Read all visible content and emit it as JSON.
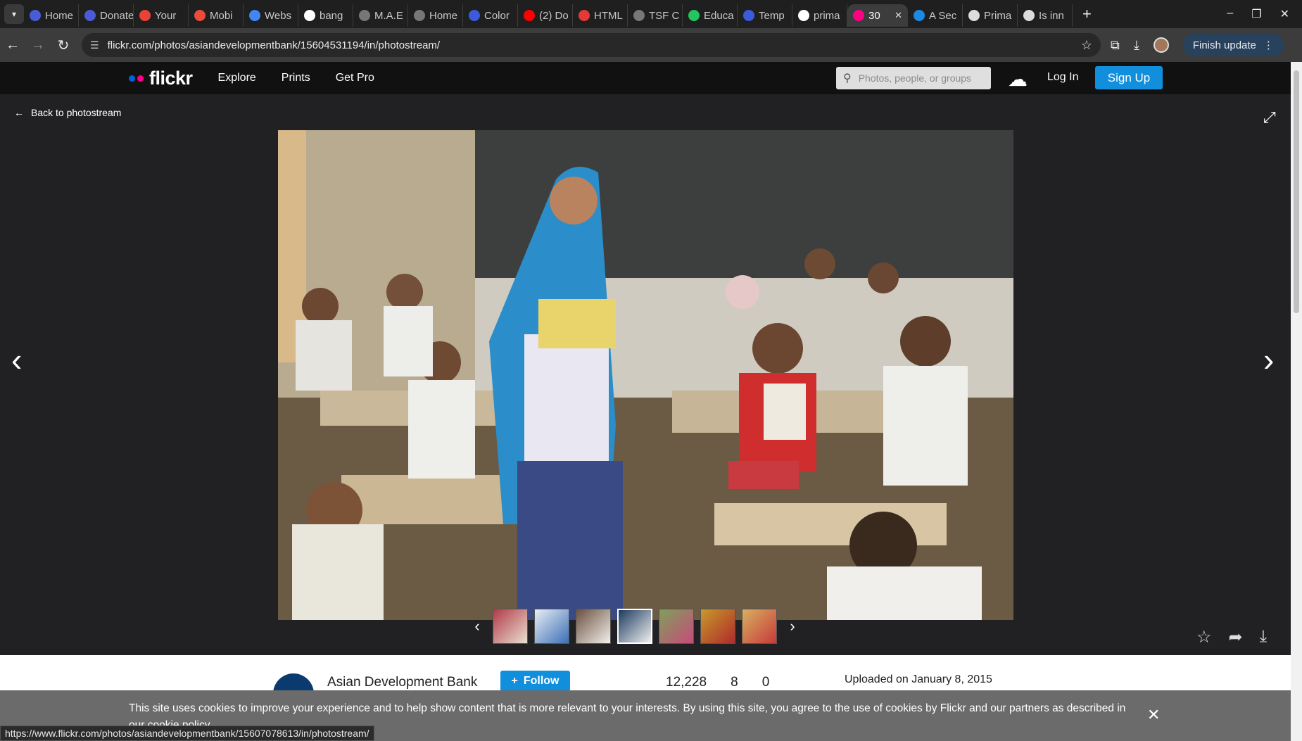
{
  "browser": {
    "tabs": [
      {
        "title": "Home",
        "color": "#4a5bd6"
      },
      {
        "title": "Donate",
        "color": "#4a5bd6"
      },
      {
        "title": "Your",
        "color": "#ea4335"
      },
      {
        "title": "Mobi",
        "color": "#e94b3c"
      },
      {
        "title": "Webs",
        "color": "#4285f4"
      },
      {
        "title": "bang",
        "color": "#ffffff"
      },
      {
        "title": "M.A.E",
        "color": "#777777"
      },
      {
        "title": "Home",
        "color": "#777777"
      },
      {
        "title": "Color",
        "color": "#3b5bdb"
      },
      {
        "title": "(2) Do",
        "color": "#ff0000"
      },
      {
        "title": "HTML",
        "color": "#e53935"
      },
      {
        "title": "TSF C",
        "color": "#777777"
      },
      {
        "title": "Educa",
        "color": "#22c55e"
      },
      {
        "title": "Temp",
        "color": "#3b5bdb"
      },
      {
        "title": "prima",
        "color": "#ffffff"
      },
      {
        "title": "30",
        "color": "#ff0084",
        "active": true
      },
      {
        "title": "A Sec",
        "color": "#1e88e5"
      },
      {
        "title": "Prima",
        "color": "#dddddd"
      },
      {
        "title": "Is inn",
        "color": "#dddddd"
      }
    ],
    "url": "flickr.com/photos/asiandevelopmentbank/15604531194/in/photostream/",
    "update_label": "Finish update",
    "status_url": "https://www.flickr.com/photos/asiandevelopmentbank/15607078613/in/photostream/"
  },
  "header": {
    "logo_text": "flickr",
    "nav": [
      "Explore",
      "Prints",
      "Get Pro"
    ],
    "search_placeholder": "Photos, people, or groups",
    "login": "Log In",
    "signup": "Sign Up",
    "brand_blue": "#128fdc",
    "logo_dot_blue": "#0063dc",
    "logo_dot_pink": "#ff0084"
  },
  "viewer": {
    "back_label": "Back to photostream",
    "thumbnails": 7
  },
  "info": {
    "owner": "Asian Development Bank",
    "follow_label": "Follow",
    "stats": [
      "12,228",
      "8",
      "0"
    ],
    "uploaded": "Uploaded on January 8, 2015"
  },
  "cookie": {
    "text": "This site uses cookies to improve your experience and to help show content that is more relevant to your interests. By using this site, you agree to the use of cookies by Flickr and our partners as described in our cookie policy."
  }
}
